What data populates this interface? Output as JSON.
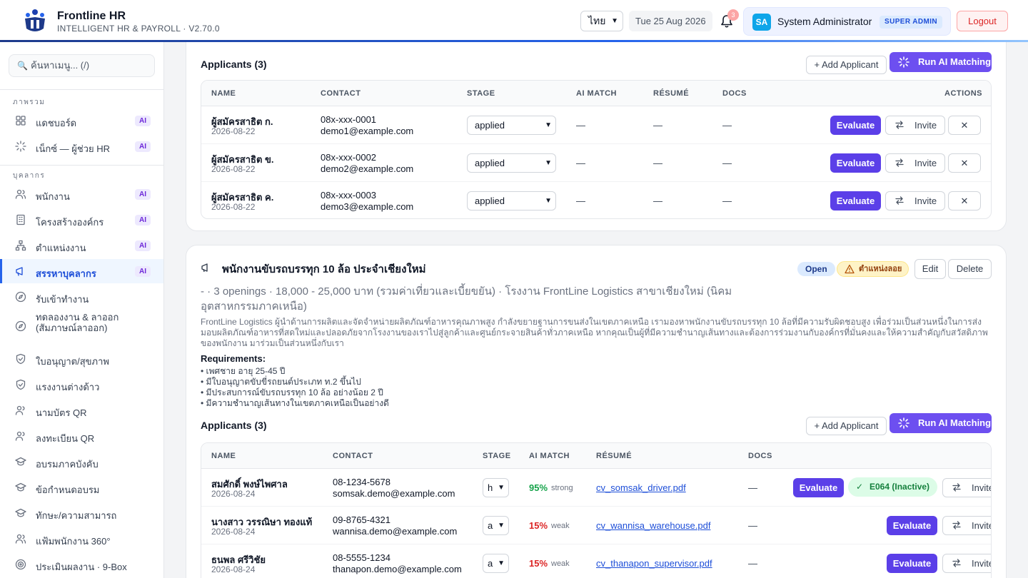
{
  "app": {
    "name": "Frontline HR",
    "subtitle": "INTELLIGENT HR & PAYROLL · V2.70.0",
    "language": "ไทย",
    "date": "Tue 25 Aug 2026",
    "notification_count": "3",
    "user_initials": "SA",
    "user_name": "System Administrator",
    "user_role": "SUPER ADMIN",
    "logout_label": "Logout"
  },
  "sidebar": {
    "search_placeholder": "ค้นหาเมนู... (/)",
    "sections": [
      {
        "title": "ภาพรวม"
      },
      {
        "title": "บุคลากร"
      }
    ],
    "items": [
      {
        "label": "แดชบอร์ด",
        "ai": "AI",
        "icon": "grid-icon"
      },
      {
        "label": "เน็กซ์ — ผู้ช่วย HR",
        "ai": "AI",
        "icon": "sparkle-icon"
      },
      {
        "label": "พนักงาน",
        "ai": "AI",
        "icon": "users-icon"
      },
      {
        "label": "โครงสร้างองค์กร",
        "ai": "AI",
        "icon": "building-icon"
      },
      {
        "label": "ตำแหน่งงาน",
        "ai": "AI",
        "icon": "org-chart-icon"
      },
      {
        "label": "สรรหาบุคลากร",
        "ai": "AI",
        "icon": "megaphone-icon"
      },
      {
        "label": "รับเข้าทำงาน",
        "icon": "compass-icon"
      },
      {
        "label": "ทดลองงาน & ลาออก (สัมภาษณ์ลาออก)",
        "line1": "ทดลองงาน & ลาออก",
        "line2": "(สัมภาษณ์ลาออก)",
        "icon": "compass-icon"
      },
      {
        "label": "ใบอนุญาต/สุขภาพ",
        "icon": "shield-check-icon"
      },
      {
        "label": "แรงงานต่างด้าว",
        "icon": "shield-check-icon"
      },
      {
        "label": "นามบัตร QR",
        "icon": "user-icon"
      },
      {
        "label": "ลงทะเบียน QR",
        "icon": "user-icon"
      },
      {
        "label": "อบรมภาคบังคับ",
        "icon": "graduation-cap-icon"
      },
      {
        "label": "ข้อกำหนดอบรม",
        "icon": "graduation-cap-icon"
      },
      {
        "label": "ทักษะ/ความสามารถ",
        "icon": "graduation-cap-icon"
      },
      {
        "label": "แฟ้มพนักงาน 360°",
        "icon": "users-icon"
      },
      {
        "label": "ประเมินผลงาน · 9-Box",
        "icon": "target-icon"
      }
    ]
  },
  "job1": {
    "applicants_heading": "Applicants (3)",
    "add_applicant_label": "+ Add Applicant",
    "run_ai_label": "Run AI Matching",
    "columns": [
      "NAME",
      "CONTACT",
      "STAGE",
      "AI MATCH",
      "RÉSUMÉ",
      "DOCS",
      "ACTIONS"
    ],
    "rows": [
      {
        "name": "ผู้สมัครสาธิต ก.",
        "date": "2026-08-22",
        "phone": "08x-xxx-0001",
        "email": "demo1@example.com",
        "stage": "applied",
        "match": "—",
        "resume": "—",
        "docs": "—"
      },
      {
        "name": "ผู้สมัครสาธิต ข.",
        "date": "2026-08-22",
        "phone": "08x-xxx-0002",
        "email": "demo2@example.com",
        "stage": "applied",
        "match": "—",
        "resume": "—",
        "docs": "—"
      },
      {
        "name": "ผู้สมัครสาธิต ค.",
        "date": "2026-08-22",
        "phone": "08x-xxx-0003",
        "email": "demo3@example.com",
        "stage": "applied",
        "match": "—",
        "resume": "—",
        "docs": "—"
      }
    ],
    "evaluate_label": "Evaluate",
    "invite_label": "Invite",
    "remove_label": "✕"
  },
  "job2": {
    "title": "พนักงานขับรถบรรทุก 10 ล้อ ประจำเชียงใหม่",
    "status": "Open",
    "floating_badge": "ตำแหน่งลอย",
    "edit_label": "Edit",
    "delete_label": "Delete",
    "meta": "- · 3 openings · 18,000 - 25,000 บาท (รวมค่าเที่ยวและเบี้ยขยัน) · โรงงาน FrontLine Logistics สาขาเชียงใหม่ (นิคมอุตสาหกรรมภาคเหนือ)",
    "description": "FrontLine Logistics ผู้นำด้านการผลิตและจัดจำหน่ายผลิตภัณฑ์อาหารคุณภาพสูง กำลังขยายฐานการขนส่งในเขตภาคเหนือ เรามองหาพนักงานขับรถบรรทุก 10 ล้อที่มีความรับผิดชอบสูง เพื่อร่วมเป็นส่วนหนึ่งในการส่งมอบผลิตภัณฑ์อาหารที่สดใหม่และปลอดภัยจากโรงงานของเราไปสู่ลูกค้าและศูนย์กระจายสินค้าทั่วภาคเหนือ หากคุณเป็นผู้ที่มีความชำนาญเส้นทางและต้องการร่วมงานกับองค์กรที่มั่นคงและให้ความสำคัญกับสวัสดิภาพของพนักงาน มาร่วมเป็นส่วนหนึ่งกับเรา",
    "requirements_title": "Requirements:",
    "requirements": [
      "• เพศชาย อายุ 25-45 ปี",
      "• มีใบอนุญาตขับขี่รถยนต์ประเภท ท.2 ขึ้นไป",
      "• มีประสบการณ์ขับรถบรรทุก 10 ล้อ อย่างน้อย 2 ปี",
      "• มีความชำนาญเส้นทางในเขตภาคเหนือเป็นอย่างดี"
    ],
    "applicants_heading": "Applicants (3)",
    "add_applicant_label": "+ Add Applicant",
    "run_ai_label": "Run AI Matching",
    "columns": [
      "NAME",
      "CONTACT",
      "STAGE",
      "AI MATCH",
      "RÉSUMÉ",
      "DOCS"
    ],
    "rows": [
      {
        "name": "สมศักดิ์ พงษ์ไพศาล",
        "date": "2026-08-24",
        "phone": "08-1234-5678",
        "email": "somsak.demo@example.com",
        "stage": "h",
        "match_pct": "95%",
        "match_label": "strong",
        "resume": "cv_somsak_driver.pdf",
        "docs": "—",
        "employee_badge": "E064 (Inactive)"
      },
      {
        "name": "นางสาว วรรณิษา ทองแท้",
        "date": "2026-08-24",
        "phone": "09-8765-4321",
        "email": "wannisa.demo@example.com",
        "stage": "a",
        "match_pct": "15%",
        "match_label": "weak",
        "resume": "cv_wannisa_warehouse.pdf",
        "docs": "—"
      },
      {
        "name": "ธนพล ศรีวิชัย",
        "date": "2026-08-24",
        "phone": "08-5555-1234",
        "email": "thanapon.demo@example.com",
        "stage": "a",
        "match_pct": "15%",
        "match_label": "weak",
        "resume": "cv_thanapon_supervisor.pdf",
        "docs": "—"
      }
    ],
    "evaluate_label": "Evaluate",
    "invite_label": "Invite",
    "colors": {
      "strong": "#16a34a",
      "weak": "#dc2626"
    }
  }
}
